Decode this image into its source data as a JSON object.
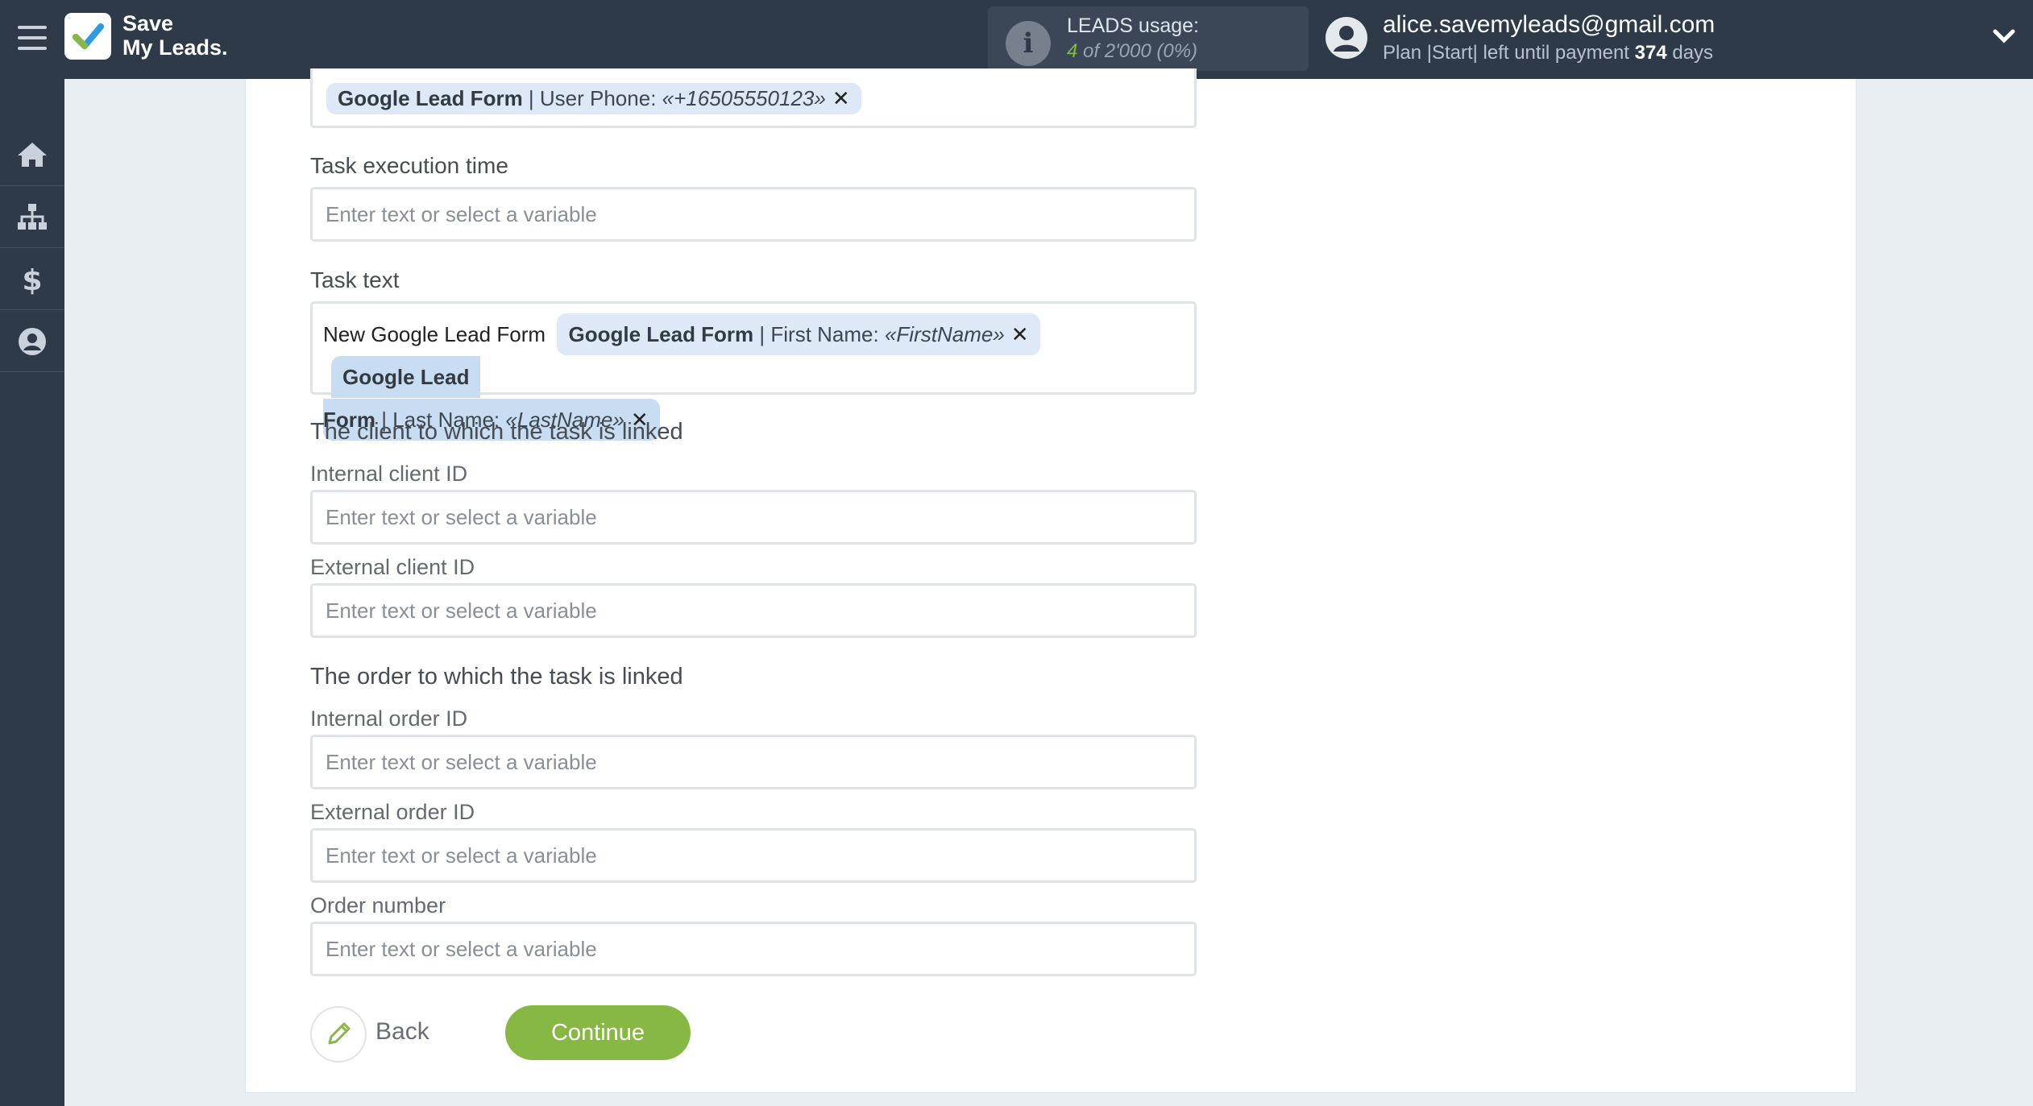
{
  "app": {
    "brand_line1": "Save",
    "brand_line2": "My Leads."
  },
  "header": {
    "leads_title": "LEADS usage:",
    "leads_used": "4",
    "leads_of": "of 2'000",
    "leads_pct": "(0%)",
    "email": "alice.savemyleads@gmail.com",
    "plan_text": "Plan |Start| left until payment",
    "days_count": "374",
    "days_label": "days"
  },
  "sidebar": {
    "items": [
      {
        "icon": "home-icon"
      },
      {
        "icon": "sitemap-icon"
      },
      {
        "icon": "dollar-icon"
      },
      {
        "icon": "user-icon"
      }
    ]
  },
  "form": {
    "phone_tag": {
      "source": "Google Lead Form",
      "field": "User Phone:",
      "value": "«+16505550123»"
    },
    "task_execution_time_label": "Task execution time",
    "placeholder": "Enter text or select a variable",
    "task_text_label": "Task text",
    "task_text_prefix": "New Google Lead Form",
    "task_text_tag1": {
      "source": "Google Lead Form",
      "field": "First Name:",
      "value": "«FirstName»"
    },
    "task_text_tag2_part1": "Google Lead",
    "task_text_tag2_part2": "Form",
    "task_text_tag2": {
      "field": "Last Name:",
      "value": "«LastName»"
    },
    "client_section_title": "The client to which the task is linked",
    "internal_client_label": "Internal client ID",
    "external_client_label": "External client ID",
    "order_section_title": "The order to which the task is linked",
    "internal_order_label": "Internal order ID",
    "external_order_label": "External order ID",
    "order_number_label": "Order number",
    "remove_symbol": "✕"
  },
  "actions": {
    "back_label": "Back",
    "continue_label": "Continue"
  },
  "colors": {
    "accent_green": "#87b843",
    "topbar": "#2e3a48",
    "tag_bg": "#dde9f6"
  }
}
